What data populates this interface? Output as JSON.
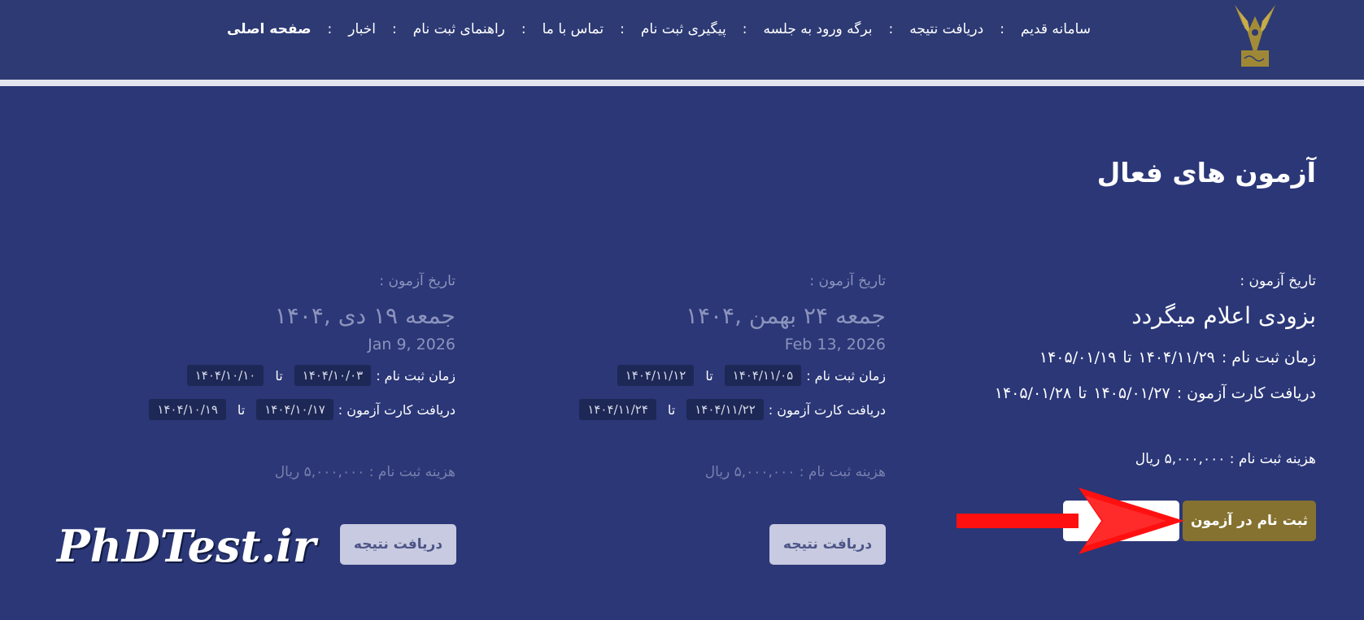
{
  "nav": {
    "items": [
      {
        "label": "صفحه اصلی",
        "active": true
      },
      {
        "label": "اخبار"
      },
      {
        "label": "راهنمای ثبت نام"
      },
      {
        "label": "تماس با ما"
      },
      {
        "label": "پیگیری ثبت نام"
      },
      {
        "label": "برگه ورود به جلسه"
      },
      {
        "label": "دریافت نتیجه"
      },
      {
        "label": "سامانه قدیم"
      }
    ],
    "separator": ":"
  },
  "logo": {
    "icon": "university-emblem-icon"
  },
  "section_title": "آزمون های فعال",
  "cards": [
    {
      "exam_date_label": "تاریخ آزمون :",
      "exam_date": "بزودی اعلام میگردد",
      "registration_label": "زمان ثبت نام :",
      "registration_from": "۱۴۰۴/۱۱/۲۹",
      "to": "تا",
      "registration_to": "۱۴۰۵/۰۱/۱۹",
      "card_label": "دریافت کارت آزمون :",
      "card_from": "۱۴۰۵/۰۱/۲۷",
      "card_to": "۱۴۰۵/۰۱/۲۸",
      "fee": "هزینه ثبت نام : ۵,۰۰۰,۰۰۰ ریال",
      "register_button": "ثبت نام در آزمون",
      "secondary_button": ""
    },
    {
      "exam_date_label": "تاریخ آزمون :",
      "exam_date": "جمعه ۲۴ بهمن ,۱۴۰۴",
      "exam_date_en": "Feb 13, 2026",
      "registration_label": "زمان ثبت نام :",
      "registration_from": "۱۴۰۴/۱۱/۰۵",
      "to": "تا",
      "registration_to": "۱۴۰۴/۱۱/۱۲",
      "card_label": "دریافت کارت آزمون :",
      "card_from": "۱۴۰۴/۱۱/۲۲",
      "card_to": "۱۴۰۴/۱۱/۲۴",
      "fee": "هزینه ثبت نام : ۵,۰۰۰,۰۰۰ ریال",
      "result_button": "دریافت نتیجه"
    },
    {
      "exam_date_label": "تاریخ آزمون :",
      "exam_date": "جمعه ۱۹ دی ,۱۴۰۴",
      "exam_date_en": "Jan 9, 2026",
      "registration_label": "زمان ثبت نام :",
      "registration_from": "۱۴۰۴/۱۰/۰۳",
      "to": "تا",
      "registration_to": "۱۴۰۴/۱۰/۱۰",
      "card_label": "دریافت کارت آزمون :",
      "card_from": "۱۴۰۴/۱۰/۱۷",
      "card_to": "۱۴۰۴/۱۰/۱۹",
      "fee": "هزینه ثبت نام : ۵,۰۰۰,۰۰۰ ریال",
      "result_button": "دریافت نتیجه"
    }
  ],
  "watermark": "PhDTest.ir",
  "annotation": {
    "icon": "red-arrow-icon",
    "color": "#ff1010"
  },
  "colors": {
    "background": "#2b3777",
    "register_button": "#857230",
    "chip": "#1d2856"
  }
}
